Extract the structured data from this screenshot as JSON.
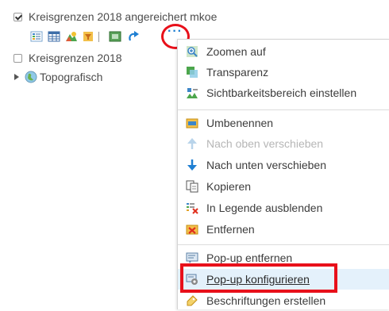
{
  "layers": {
    "item1_label": "Kreisgrenzen 2018 angereichert mkoe",
    "item2_label": "Kreisgrenzen 2018",
    "item3_label": "Topografisch"
  },
  "toolbar": {
    "more_label": "···"
  },
  "menu": {
    "zoom": "Zoomen auf",
    "transparency": "Transparenz",
    "visibility_range": "Sichtbarkeitsbereich einstellen",
    "rename": "Umbenennen",
    "move_up": "Nach oben verschieben",
    "move_down": "Nach unten verschieben",
    "copy": "Kopieren",
    "hide_legend": "In Legende ausblenden",
    "remove": "Entfernen",
    "popup_remove": "Pop-up entfernen",
    "popup_configure": "Pop-up konfigurieren",
    "create_labels": "Beschriftungen erstellen"
  },
  "colors": {
    "accent_blue": "#1f7fd2",
    "highlight_red": "#e8101a",
    "hover_bg": "#e4f1fb"
  }
}
